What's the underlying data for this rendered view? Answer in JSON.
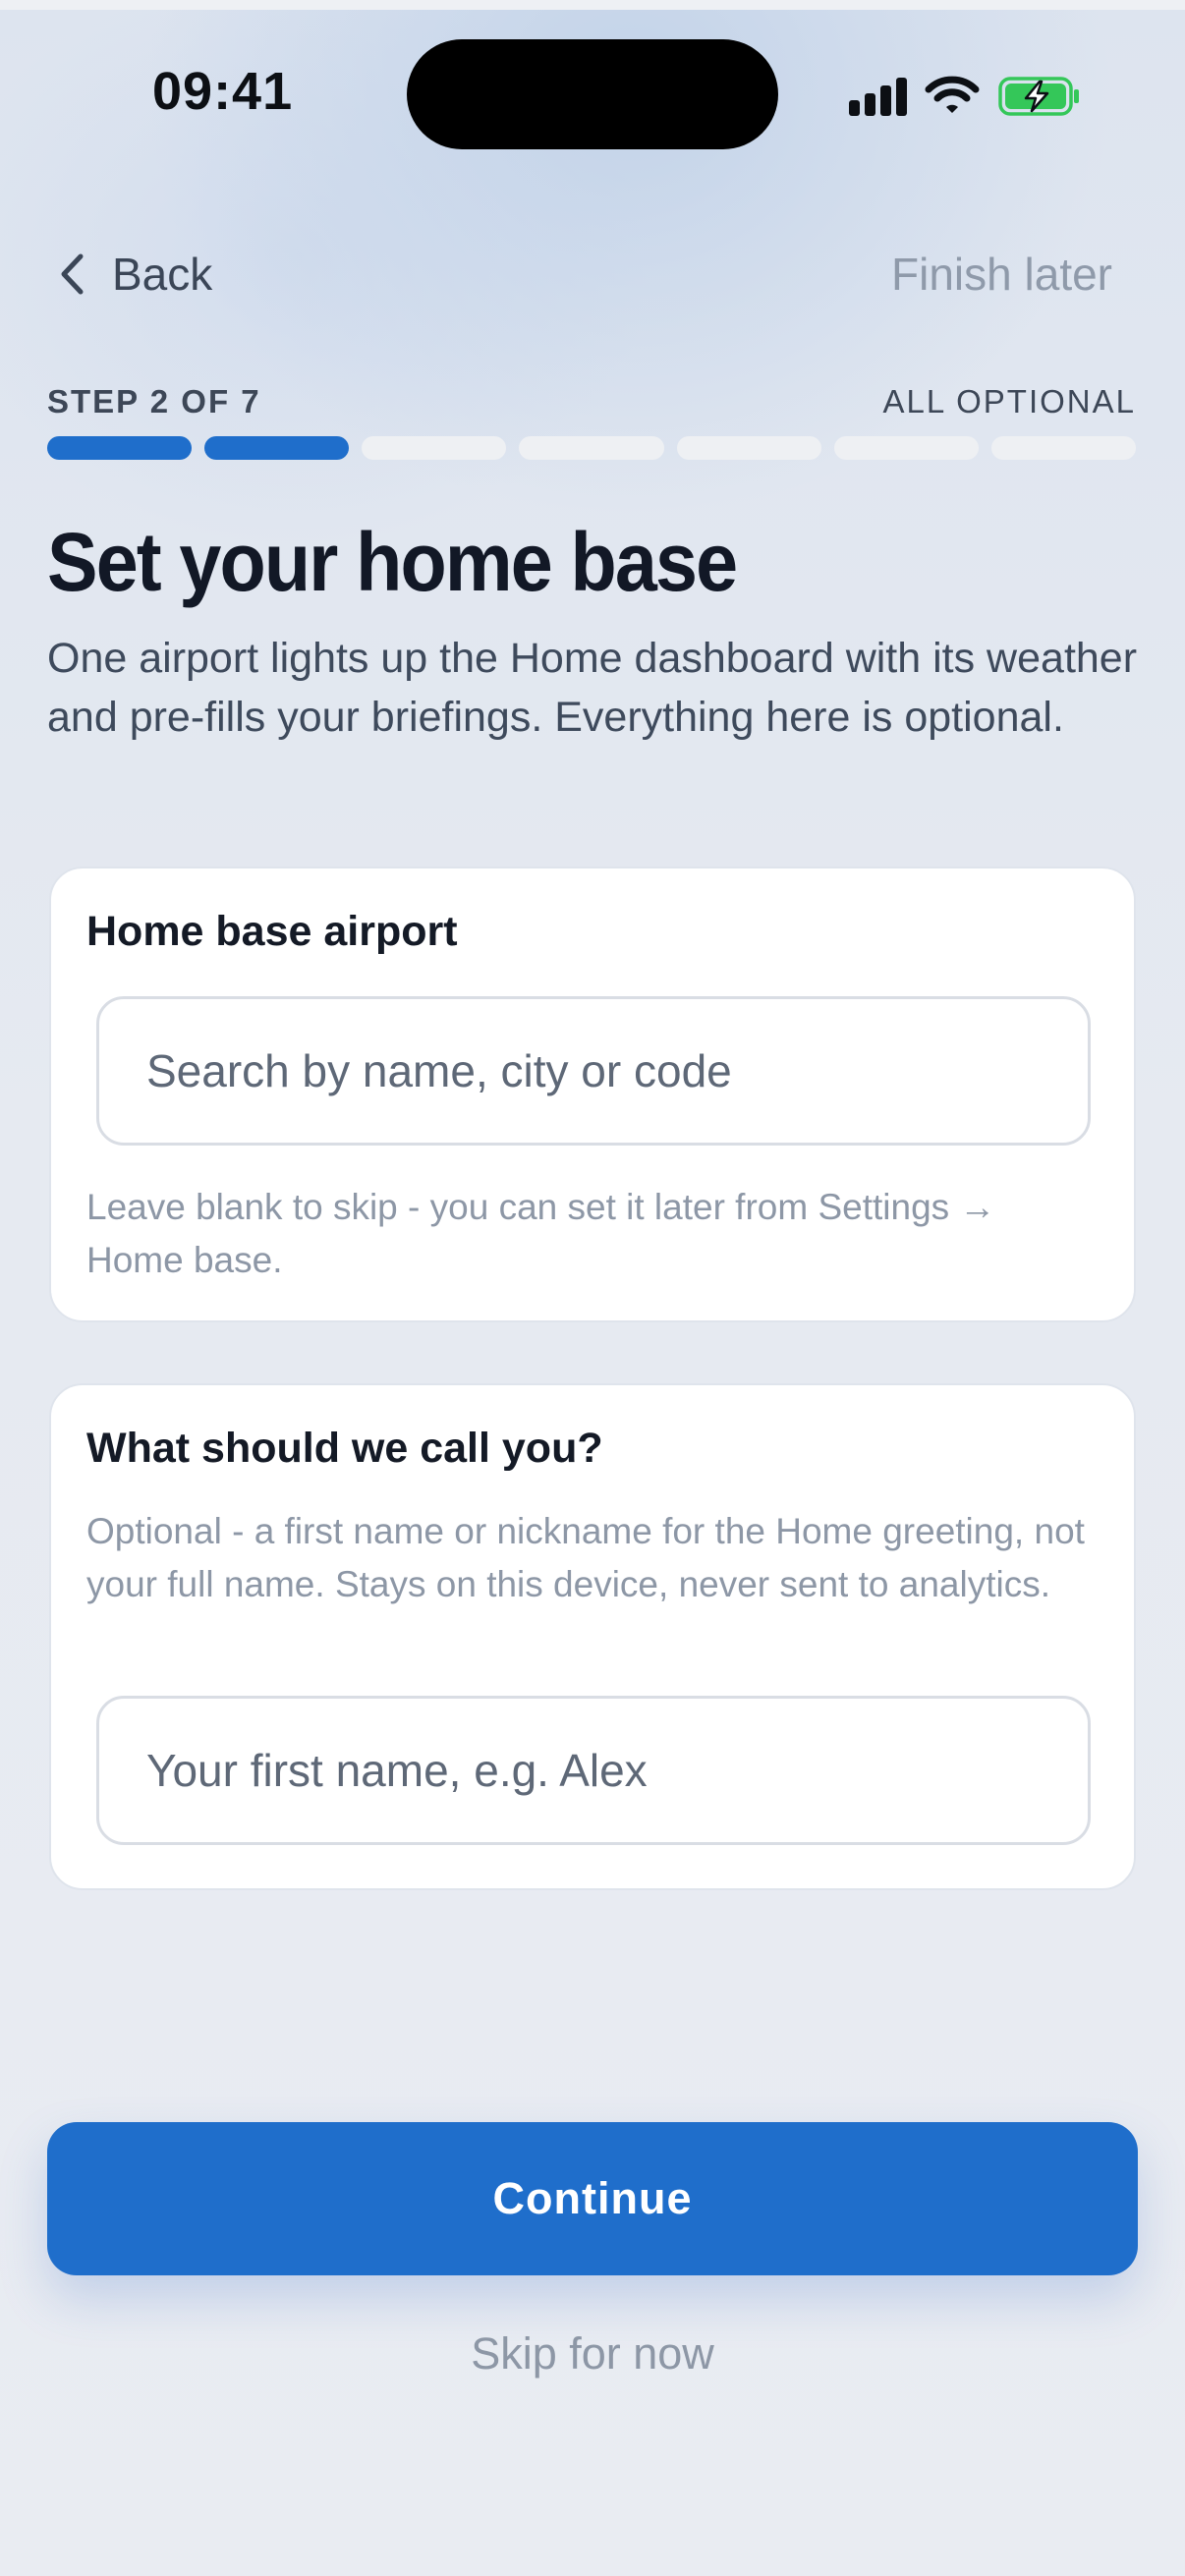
{
  "status_bar": {
    "time": "09:41",
    "icons": [
      "cellular-signal-icon",
      "wifi-icon",
      "battery-charging-icon"
    ],
    "battery_color": "#34c759"
  },
  "nav": {
    "back_label": "Back",
    "finish_later_label": "Finish later"
  },
  "stepper": {
    "step_label": "STEP 2 OF 7",
    "optional_label": "ALL OPTIONAL",
    "current_step": 2,
    "total_steps": 7,
    "active_color": "#1f6ecb"
  },
  "header": {
    "title": "Set your home base",
    "subtitle": "One airport lights up the Home dashboard with its weather and pre-fills your briefings. Everything here is optional."
  },
  "home_base_card": {
    "title": "Home base airport",
    "search_placeholder": "Search by name, city or code",
    "search_value": "",
    "hint": "Leave blank to skip - you can set it later from Settings → Home base."
  },
  "name_card": {
    "title": "What should we call you?",
    "hint": "Optional - a first name or nickname for the Home greeting, not your full name. Stays on this device, never sent to analytics.",
    "name_placeholder": "Your first name, e.g. Alex",
    "name_value": ""
  },
  "actions": {
    "continue_label": "Continue",
    "skip_label": "Skip for now",
    "primary_color": "#1f6ecb"
  }
}
